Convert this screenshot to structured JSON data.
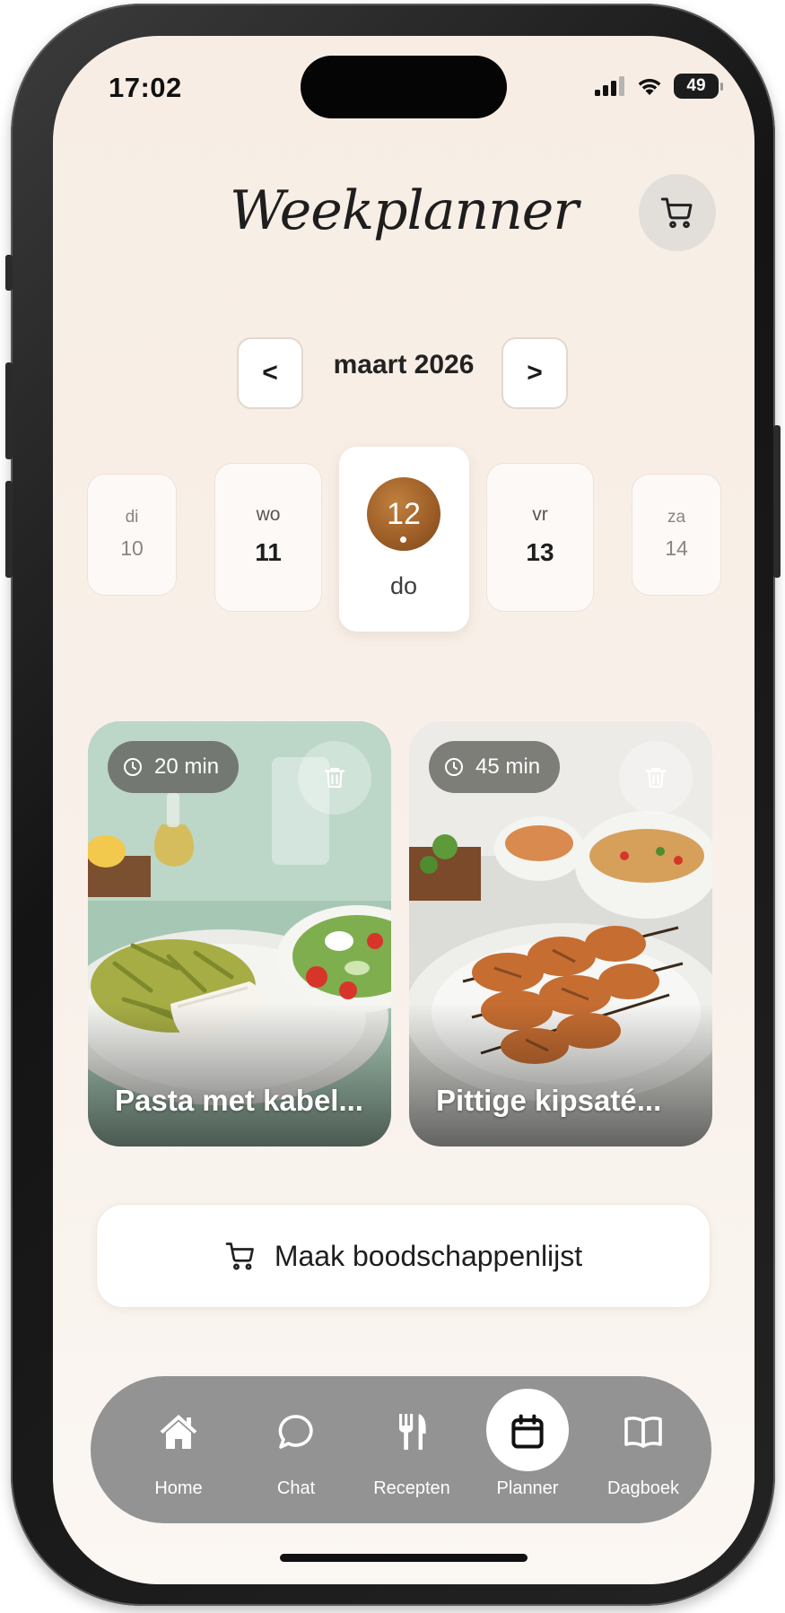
{
  "status_bar": {
    "time": "17:02",
    "battery": "49"
  },
  "header": {
    "title": "Weekplanner",
    "cart_icon": "shopping-cart-icon"
  },
  "month_nav": {
    "prev_label": "<",
    "month": "maart 2026",
    "next_label": ">"
  },
  "days": [
    {
      "weekday": "di",
      "day": "10"
    },
    {
      "weekday": "wo",
      "day": "11"
    },
    {
      "weekday": "do",
      "day": "12",
      "selected": true
    },
    {
      "weekday": "vr",
      "day": "13"
    },
    {
      "weekday": "za",
      "day": "14"
    }
  ],
  "recipes": [
    {
      "time": "20 min",
      "title": "Pasta met kabel...",
      "icon": "clock-icon",
      "delete_icon": "trash-icon"
    },
    {
      "time": "45 min",
      "title": "Pittige kipsaté...",
      "icon": "clock-icon",
      "delete_icon": "trash-icon"
    }
  ],
  "shopping_button": {
    "label": "Maak boodschappenlijst",
    "icon": "shopping-cart-icon"
  },
  "tabbar": {
    "items": [
      {
        "label": "Home",
        "icon": "home-icon"
      },
      {
        "label": "Chat",
        "icon": "chat-bubble-icon"
      },
      {
        "label": "Recepten",
        "icon": "fork-knife-icon"
      },
      {
        "label": "Planner",
        "icon": "calendar-icon",
        "active": true
      },
      {
        "label": "Dagboek",
        "icon": "book-icon"
      }
    ]
  },
  "colors": {
    "background": "#f7ede4",
    "accent": "#9b5c26",
    "tabbar": "#939393"
  }
}
